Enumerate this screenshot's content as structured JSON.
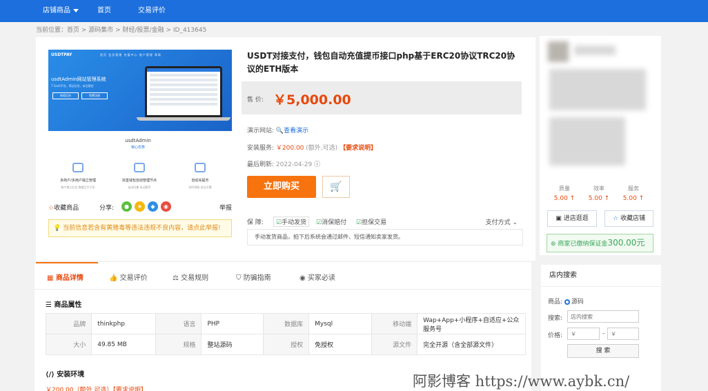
{
  "nav": {
    "store": "店铺商品",
    "home": "首页",
    "reviews": "交易评价"
  },
  "breadcrumb": "当前位置：首页 > 源码集市 > 财经/股票/金融 > ID_413645",
  "banner": {
    "brand": "USDTPAY",
    "menu": "首页  会员管理  充值中心  账户管理  帮助",
    "title": "usdtAdmin网站管理系统",
    "subtitle": "T SaaS平台，简洁后台，安全稳定",
    "btn1": "体验后台",
    "btn2": "免费注册"
  },
  "product_sub": {
    "name": "usdtAdmin",
    "tag": "核心优势"
  },
  "features": [
    {
      "title": "多商户/多用户独立管理",
      "desc": "商户独立后台 数据互不干扰"
    },
    {
      "title": "完善钱包自动管理节点",
      "desc": "自动归集 自动提币"
    },
    {
      "title": "自动充提币",
      "desc": "实时到账 安全可靠"
    }
  ],
  "share": {
    "fav": "收藏商品",
    "share": "分享:",
    "report": "举报"
  },
  "warning": "当前信息若含有黄赌毒等违法违规不良内容，请点此举报!",
  "title": "USDT对接支付，钱包自动充值提币接口php基于ERC20协议TRC20协议的ETH版本",
  "price": {
    "label": "售 价:",
    "value": "￥5,000.00"
  },
  "demo": {
    "label": "演示网站:",
    "link": "查看演示"
  },
  "install": {
    "label": "安装服务:",
    "price": "￥200.00",
    "note": "(额外,可选)",
    "req": "【要求说明】"
  },
  "refresh": {
    "label": "最后刷新:",
    "date": "2022-04-29"
  },
  "buy": "立即购买",
  "guarantee": {
    "label": "保 障:",
    "items": [
      "手动发货",
      "消保赔付",
      "担保交易"
    ],
    "pay": "支付方式"
  },
  "delivery_note": "手动发货商品，拍下后系统会通过邮件、短信通知卖家发货。",
  "ratings": [
    {
      "label": "质量",
      "value": "5.00 ↑"
    },
    {
      "label": "效率",
      "value": "5.00 ↑"
    },
    {
      "label": "服务",
      "value": "5.00 ↑"
    }
  ],
  "seller_buttons": {
    "enter": "进店逛逛",
    "fav": "收藏店铺"
  },
  "deposit": {
    "text": "商家已缴纳保证金",
    "amount": "300.00元"
  },
  "tabs": [
    "商品详情",
    "交易评价",
    "交易规则",
    "防骗指南",
    "买家必读"
  ],
  "attrs_title": "商品属性",
  "attrs": [
    [
      "品牌",
      "thinkphp",
      "语言",
      "PHP",
      "数据库",
      "Mysql",
      "移动端",
      "Wap+App+小程序+自适应+公众服务号"
    ],
    [
      "大小",
      "49.85 MB",
      "规格",
      "整站源码",
      "授权",
      "免授权",
      "源文件",
      "完全开源（含全部源文件）"
    ]
  ],
  "env_title": "安装环境",
  "env_peek": "￥200.00（额外,可选）【要求说明】",
  "search": {
    "title": "店内搜索",
    "product_label": "商品:",
    "product_option": "源码",
    "keyword_label": "搜索:",
    "keyword_placeholder": "店内搜索",
    "price_label": "价格:",
    "min_placeholder": "￥",
    "max_placeholder": "￥",
    "dash": "-",
    "button": "搜 索"
  },
  "watermark": "阿影博客 https://www.aybk.cn/",
  "colors": {
    "topbar": "#1c6fdc",
    "accent": "#f7730e",
    "price": "#e8480c",
    "success": "#3aa65b"
  }
}
